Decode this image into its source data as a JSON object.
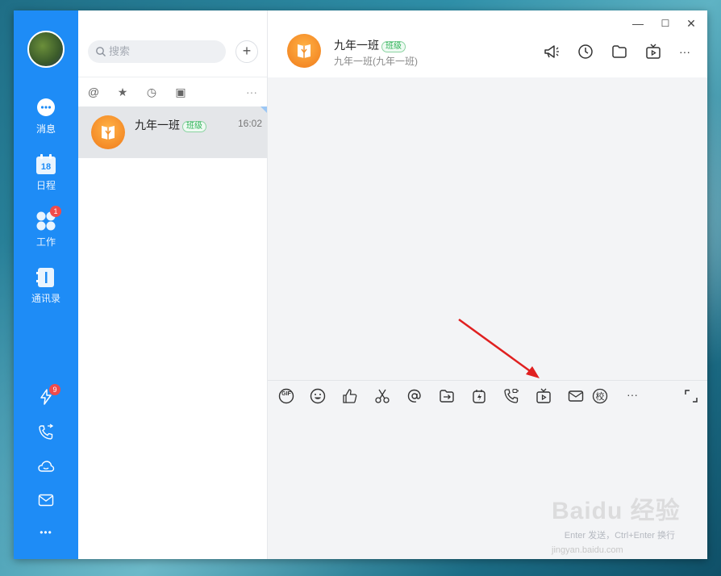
{
  "rail": {
    "items": [
      {
        "label": "消息",
        "icon": "chat-bubble-icon"
      },
      {
        "label": "日程",
        "icon": "calendar-icon",
        "day": "18"
      },
      {
        "label": "工作",
        "icon": "apps-icon",
        "badge": "1"
      },
      {
        "label": "通讯录",
        "icon": "contacts-icon"
      }
    ],
    "bottom": [
      {
        "icon": "lightning-icon",
        "badge": "9"
      },
      {
        "icon": "phone-icon"
      },
      {
        "icon": "cloud-icon"
      },
      {
        "icon": "mail-icon"
      },
      {
        "icon": "more-icon",
        "glyph": "•••"
      }
    ]
  },
  "list": {
    "search_placeholder": "搜索",
    "add_label": "+",
    "filters": [
      "@",
      "★",
      "◷",
      "▣",
      "···"
    ],
    "conversations": [
      {
        "name": "九年一班",
        "tag": "班级",
        "time": "16:02"
      }
    ]
  },
  "chat": {
    "title": "九年一班",
    "tag": "班级",
    "subtitle": "九年一班(九年一班)",
    "window_controls": [
      "—",
      "☐",
      "✕"
    ],
    "toolbar": [
      {
        "icon": "gif-icon",
        "text": "GIF"
      },
      {
        "icon": "emoji-icon"
      },
      {
        "icon": "thumbs-up-icon"
      },
      {
        "icon": "scissors-icon"
      },
      {
        "icon": "at-icon"
      },
      {
        "icon": "share-icon"
      },
      {
        "icon": "flash-icon"
      },
      {
        "icon": "call-icon"
      },
      {
        "icon": "live-tv-icon"
      },
      {
        "icon": "mail-icon"
      },
      {
        "icon": "school-icon",
        "text": "校"
      },
      {
        "icon": "more-icon",
        "text": "···"
      }
    ],
    "hint": "Enter 发送，Ctrl+Enter 换行",
    "accent": "#1e8cf6"
  },
  "watermark": {
    "main": "Baidu 经验",
    "sub": "jingyan.baidu.com"
  }
}
